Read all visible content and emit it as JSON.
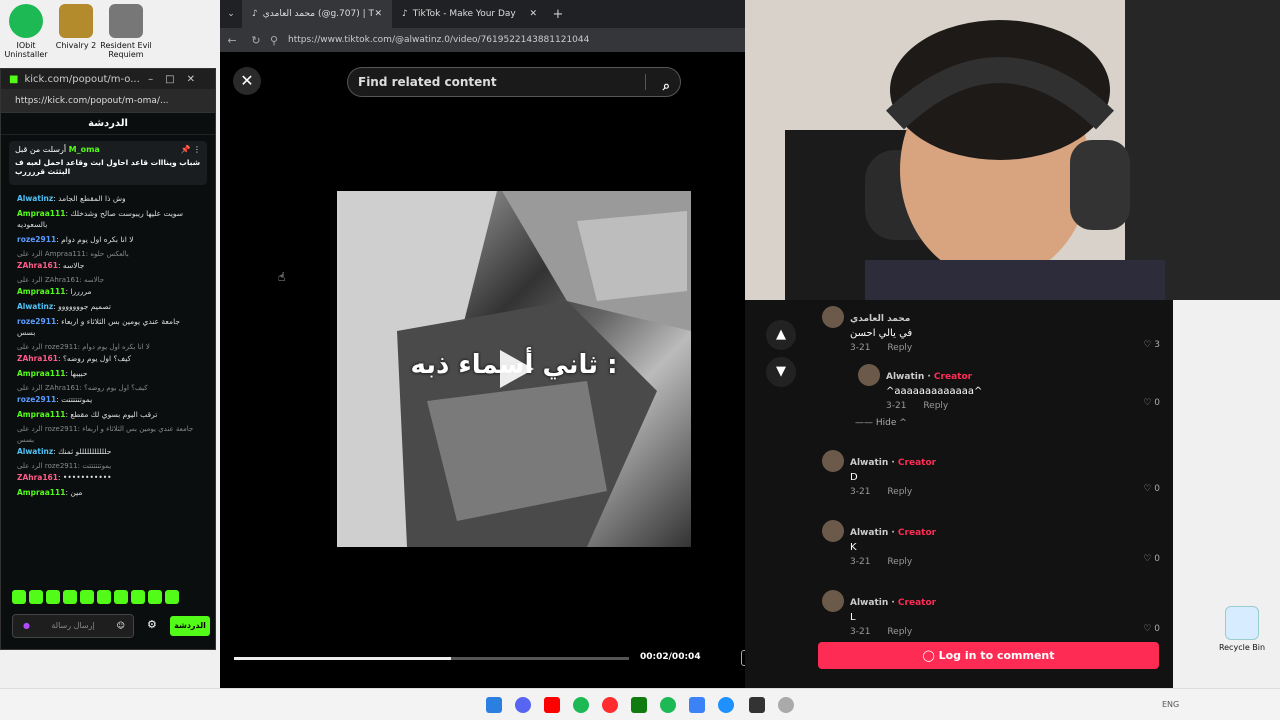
{
  "desktop": {
    "icons": [
      {
        "label": "IObit Uninstaller",
        "color": "#1db954"
      },
      {
        "label": "Chivalry 2",
        "color": "#b38b2c"
      },
      {
        "label": "Resident Evil Requiem",
        "color": "#777777"
      }
    ],
    "recycle_bin": "Recycle Bin"
  },
  "kick": {
    "title": "kick.com/popout/m-o...",
    "url": "https://kick.com/popout/m-oma/...",
    "chat_header": "الدردشة",
    "pinned": {
      "pinned_by": "أرسلت من قبل",
      "user": "M_oma",
      "text": "شباب وينااات قاعد احاول ابث وقاعد احمل لعبه ف البثثث قررررب"
    },
    "messages": [
      {
        "user": "Alwatinz",
        "color": "#4fc3f7",
        "text": "وش ذا المقطع الجامد"
      },
      {
        "user": "Ampraa111",
        "color": "#53fc18",
        "text": "سويت عليها ريبوست صالح وشدخلك بالسعوديه"
      },
      {
        "user": "roze2911",
        "color": "#5b9cff",
        "text": "لا انا بكره اول يوم دوام"
      },
      {
        "reply": "الرد على Ampraa111: بالعكس حلوه",
        "user": "ZAhra161",
        "color": "#ff5c8a",
        "text": "جالاسه"
      },
      {
        "reply": "الرد على ZAhra161: جالاسه",
        "user": "Ampraa111",
        "color": "#53fc18",
        "text": "مررررا"
      },
      {
        "user": "Alwatinz",
        "color": "#4fc3f7",
        "text": "تصميم جووووووو"
      },
      {
        "user": "roze2911",
        "color": "#5b9cff",
        "text": "جامعة عندي يومين بس الثلاثاء و اربعاء بسس"
      },
      {
        "reply": "الرد على roze2911: لا انا بكره اول يوم دوام",
        "user": "ZAhra161",
        "color": "#ff5c8a",
        "text": "كيف؟ اول يوم روضه؟"
      },
      {
        "user": "Ampraa111",
        "color": "#53fc18",
        "text": "حبيبها"
      },
      {
        "reply": "الرد على ZAhra161: كيف؟ اول يوم روضه؟",
        "user": "roze2911",
        "color": "#5b9cff",
        "text": "يموتتتتتتت"
      },
      {
        "user": "Ampraa111",
        "color": "#53fc18",
        "text": "ترقب اليوم بسوي لك مقطع"
      },
      {
        "reply": "الرد على roze2911: جامعة عندي يومين بس الثلاثاء و اربعاء بسس",
        "user": "Alwatinz",
        "color": "#4fc3f7",
        "text": "حلللللللللللو ثمنك"
      },
      {
        "reply": "الرد على roze2911: يموتتتتتتت",
        "user": "ZAhra161",
        "color": "#ff5c8a",
        "text": "•••••••••••"
      },
      {
        "user": "Ampraa111",
        "color": "#53fc18",
        "text": "مين"
      }
    ],
    "send_placeholder": "إرسال رسالة",
    "chat_button": "الدردشة"
  },
  "browser": {
    "tabs": [
      {
        "label": "محمد العامدي (@g.707) | TikTok",
        "active": true
      },
      {
        "label": "TikTok - Make Your Day",
        "active": false
      }
    ],
    "url": "https://www.tiktok.com/@alwatinz.0/video/7619522143881121044"
  },
  "tiktok": {
    "search_placeholder": "Find related content",
    "video_caption": "ثاني أسماء ذبه :",
    "time": "00:02/00:04",
    "progress": 0.55,
    "comments": [
      {
        "name": "محمد العامدي",
        "text": "في يالي احسن",
        "date": "3-21",
        "reply": "Reply",
        "likes": "3",
        "indent": false
      },
      {
        "name": "Alwatin",
        "creator": "Creator",
        "text": "^aaaaaaaaaaaaa^",
        "date": "3-21",
        "reply": "Reply",
        "likes": "0",
        "indent": true
      },
      {
        "name": "Alwatin",
        "creator": "Creator",
        "text": "D",
        "date": "3-21",
        "reply": "Reply",
        "likes": "0",
        "indent": false
      },
      {
        "name": "Alwatin",
        "creator": "Creator",
        "text": "K",
        "date": "3-21",
        "reply": "Reply",
        "likes": "0",
        "indent": false
      },
      {
        "name": "Alwatin",
        "creator": "Creator",
        "text": "L",
        "date": "3-21",
        "reply": "Reply",
        "likes": "0",
        "indent": false
      }
    ],
    "hide_label": "Hide",
    "login_button": "Log in to comment"
  },
  "taskbar": {
    "lang": "ENG"
  }
}
